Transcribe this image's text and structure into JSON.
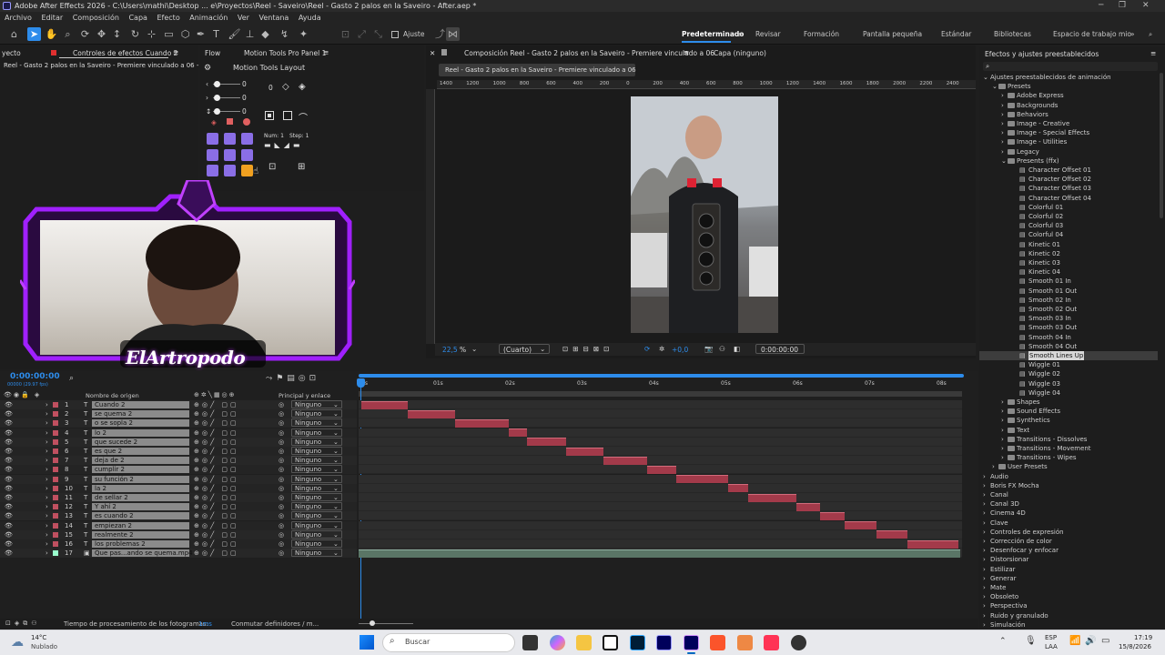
{
  "window": {
    "title": "Adobe After Effects 2026 - C:\\Users\\mathi\\Desktop ... e\\Proyectos\\Reel - Saveiro\\Reel - Gasto 2 palos en la Saveiro - After.aep *"
  },
  "menu": [
    "Archivo",
    "Editar",
    "Composición",
    "Capa",
    "Efecto",
    "Animación",
    "Ver",
    "Ventana",
    "Ayuda"
  ],
  "toolbar": {
    "ajuste_label": "Ajuste"
  },
  "workspaces": [
    "Predeterminado",
    "Revisar",
    "Formación",
    "Pantalla pequeña",
    "Estándar",
    "Bibliotecas",
    "Espacio de trabajo mio"
  ],
  "left_panel": {
    "tab1": "yecto",
    "tab2": "Controles de efectos Cuando 2",
    "breadcrumb": "Reel - Gasto 2 palos en la Saveiro - Premiere vinculado a 06 - Cuando 2"
  },
  "motion_tools": {
    "tab_flow": "Flow",
    "tab_panel": "Motion Tools Pro Panel 1",
    "title": "Motion Tools Layout",
    "values": [
      "0",
      "0",
      "0",
      "0"
    ],
    "num_label": "Num: 1",
    "step_label": "Step: 1"
  },
  "overlay": {
    "brand": "ElArtropodo"
  },
  "comp": {
    "tab": "Composición Reel - Gasto 2 palos en la Saveiro - Premiere vinculado a 06",
    "layer_tab": "Capa (ninguno)",
    "breadcrumb": "Reel - Gasto 2 palos en la Saveiro - Premiere vinculado a 06",
    "ruler": [
      "1400",
      "1200",
      "1000",
      "800",
      "600",
      "400",
      "200",
      "0",
      "200",
      "400",
      "600",
      "800",
      "1000",
      "1200",
      "1400",
      "1600",
      "1800",
      "2000",
      "2200",
      "2400"
    ],
    "zoom": "22,5",
    "quality": "(Cuarto)",
    "exposure": "+0,0",
    "timecode": "0:00:00:00"
  },
  "timeline": {
    "timecode": "0:00:00:00",
    "sub_timecode": "00000 (29.97 fps)",
    "col_name": "Nombre de origen",
    "col_parent": "Principal y enlace",
    "ruler": [
      "0s",
      "01s",
      "02s",
      "03s",
      "04s",
      "05s",
      "06s",
      "07s",
      "08s"
    ],
    "layers": [
      {
        "num": "1",
        "name": "Cuando 2",
        "parent": "Ninguno",
        "start": 0.0,
        "end": 0.65
      },
      {
        "num": "2",
        "name": "se quema 2",
        "parent": "Ninguno",
        "start": 0.65,
        "end": 1.3
      },
      {
        "num": "3",
        "name": "o se sopla 2",
        "parent": "Ninguno",
        "start": 1.3,
        "end": 2.05
      },
      {
        "num": "4",
        "name": "lo 2",
        "parent": "Ninguno",
        "start": 2.05,
        "end": 2.3
      },
      {
        "num": "5",
        "name": "que sucede 2",
        "parent": "Ninguno",
        "start": 2.3,
        "end": 2.85
      },
      {
        "num": "6",
        "name": "es que 2",
        "parent": "Ninguno",
        "start": 2.85,
        "end": 3.37
      },
      {
        "num": "7",
        "name": "deja de 2",
        "parent": "Ninguno",
        "start": 3.37,
        "end": 3.98
      },
      {
        "num": "8",
        "name": "cumplir 2",
        "parent": "Ninguno",
        "start": 3.98,
        "end": 4.38
      },
      {
        "num": "9",
        "name": "su función 2",
        "parent": "Ninguno",
        "start": 4.38,
        "end": 5.1
      },
      {
        "num": "10",
        "name": "la 2",
        "parent": "Ninguno",
        "start": 5.1,
        "end": 5.38
      },
      {
        "num": "11",
        "name": "de sellar 2",
        "parent": "Ninguno",
        "start": 5.38,
        "end": 6.05
      },
      {
        "num": "12",
        "name": "Y ahí 2",
        "parent": "Ninguno",
        "start": 6.05,
        "end": 6.38
      },
      {
        "num": "13",
        "name": "es cuando 2",
        "parent": "Ninguno",
        "start": 6.38,
        "end": 6.72
      },
      {
        "num": "14",
        "name": "empiezan 2",
        "parent": "Ninguno",
        "start": 6.72,
        "end": 7.17
      },
      {
        "num": "15",
        "name": "realmente 2",
        "parent": "Ninguno",
        "start": 7.17,
        "end": 7.6
      },
      {
        "num": "16",
        "name": "los problemas 2",
        "parent": "Ninguno",
        "start": 7.6,
        "end": 8.3
      },
      {
        "num": "17",
        "name": "Que pas...ando se quema.mp4",
        "parent": "Ninguno",
        "start": 0.0,
        "end": 8.3
      }
    ],
    "status": "Tiempo de procesamiento de los fotogramas:",
    "status_value": "1ms",
    "toggle": "Conmutar definidores / m..."
  },
  "presets": {
    "title": "Efectos y ajustes preestablecidos",
    "items": [
      {
        "label": "Ajustes preestablecidos de animación",
        "level": 0,
        "kind": "open"
      },
      {
        "label": "Presets",
        "level": 1,
        "kind": "open"
      },
      {
        "label": "Adobe Express",
        "level": 2,
        "kind": "folder"
      },
      {
        "label": "Backgrounds",
        "level": 2,
        "kind": "folder"
      },
      {
        "label": "Behaviors",
        "level": 2,
        "kind": "folder"
      },
      {
        "label": "Image - Creative",
        "level": 2,
        "kind": "folder"
      },
      {
        "label": "Image - Special Effects",
        "level": 2,
        "kind": "folder"
      },
      {
        "label": "Image - Utilities",
        "level": 2,
        "kind": "folder"
      },
      {
        "label": "Legacy",
        "level": 2,
        "kind": "folder"
      },
      {
        "label": "Presents (ffx)",
        "level": 2,
        "kind": "open"
      },
      {
        "label": "Character Offset 01",
        "level": 3,
        "kind": "file"
      },
      {
        "label": "Character Offset 02",
        "level": 3,
        "kind": "file"
      },
      {
        "label": "Character Offset 03",
        "level": 3,
        "kind": "file"
      },
      {
        "label": "Character Offset 04",
        "level": 3,
        "kind": "file"
      },
      {
        "label": "Colorful 01",
        "level": 3,
        "kind": "file"
      },
      {
        "label": "Colorful 02",
        "level": 3,
        "kind": "file"
      },
      {
        "label": "Colorful 03",
        "level": 3,
        "kind": "file"
      },
      {
        "label": "Colorful 04",
        "level": 3,
        "kind": "file"
      },
      {
        "label": "Kinetic 01",
        "level": 3,
        "kind": "file"
      },
      {
        "label": "Kinetic 02",
        "level": 3,
        "kind": "file"
      },
      {
        "label": "Kinetic 03",
        "level": 3,
        "kind": "file"
      },
      {
        "label": "Kinetic 04",
        "level": 3,
        "kind": "file"
      },
      {
        "label": "Smooth 01 In",
        "level": 3,
        "kind": "file"
      },
      {
        "label": "Smooth 01 Out",
        "level": 3,
        "kind": "file"
      },
      {
        "label": "Smooth 02 In",
        "level": 3,
        "kind": "file"
      },
      {
        "label": "Smooth 02 Out",
        "level": 3,
        "kind": "file"
      },
      {
        "label": "Smooth 03 In",
        "level": 3,
        "kind": "file"
      },
      {
        "label": "Smooth 03 Out",
        "level": 3,
        "kind": "file"
      },
      {
        "label": "Smooth 04 In",
        "level": 3,
        "kind": "file"
      },
      {
        "label": "Smooth 04 Out",
        "level": 3,
        "kind": "file"
      },
      {
        "label": "Smooth Lines Up",
        "level": 3,
        "kind": "file",
        "selected": true
      },
      {
        "label": "Wiggle 01",
        "level": 3,
        "kind": "file"
      },
      {
        "label": "Wiggle 02",
        "level": 3,
        "kind": "file"
      },
      {
        "label": "Wiggle 03",
        "level": 3,
        "kind": "file"
      },
      {
        "label": "Wiggle 04",
        "level": 3,
        "kind": "file"
      },
      {
        "label": "Shapes",
        "level": 2,
        "kind": "folder"
      },
      {
        "label": "Sound Effects",
        "level": 2,
        "kind": "folder"
      },
      {
        "label": "Synthetics",
        "level": 2,
        "kind": "folder"
      },
      {
        "label": "Text",
        "level": 2,
        "kind": "folder"
      },
      {
        "label": "Transitions - Dissolves",
        "level": 2,
        "kind": "folder"
      },
      {
        "label": "Transitions - Movement",
        "level": 2,
        "kind": "folder"
      },
      {
        "label": "Transitions - Wipes",
        "level": 2,
        "kind": "folder"
      },
      {
        "label": "User Presets",
        "level": 1,
        "kind": "folder"
      },
      {
        "label": "Audio",
        "level": 0,
        "kind": "closed"
      },
      {
        "label": "Boris FX Mocha",
        "level": 0,
        "kind": "closed"
      },
      {
        "label": "Canal",
        "level": 0,
        "kind": "closed"
      },
      {
        "label": "Canal 3D",
        "level": 0,
        "kind": "closed"
      },
      {
        "label": "Cinema 4D",
        "level": 0,
        "kind": "closed"
      },
      {
        "label": "Clave",
        "level": 0,
        "kind": "closed"
      },
      {
        "label": "Controles de expresión",
        "level": 0,
        "kind": "closed"
      },
      {
        "label": "Corrección de color",
        "level": 0,
        "kind": "closed"
      },
      {
        "label": "Desenfocar y enfocar",
        "level": 0,
        "kind": "closed"
      },
      {
        "label": "Distorsionar",
        "level": 0,
        "kind": "closed"
      },
      {
        "label": "Estilizar",
        "level": 0,
        "kind": "closed"
      },
      {
        "label": "Generar",
        "level": 0,
        "kind": "closed"
      },
      {
        "label": "Mate",
        "level": 0,
        "kind": "closed"
      },
      {
        "label": "Obsoleto",
        "level": 0,
        "kind": "closed"
      },
      {
        "label": "Perspectiva",
        "level": 0,
        "kind": "closed"
      },
      {
        "label": "Ruido y granulado",
        "level": 0,
        "kind": "closed"
      },
      {
        "label": "Simulación",
        "level": 0,
        "kind": "closed"
      }
    ]
  },
  "taskbar": {
    "weather_temp": "14°C",
    "weather_desc": "Nublado",
    "search": "Buscar",
    "lang1": "ESP",
    "lang2": "LAA",
    "time": "17:19",
    "date": "15/8/2026"
  },
  "colors": {
    "accent": "#2d8ceb",
    "label_red": "#a33a4a",
    "purple": "#8a6ee6",
    "orange": "#f0a020"
  }
}
